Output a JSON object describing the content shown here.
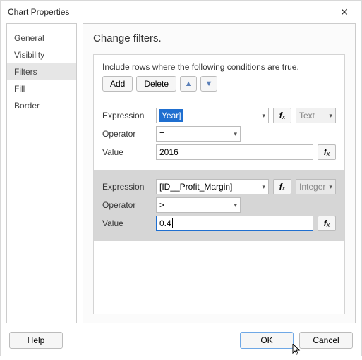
{
  "dialog": {
    "title": "Chart Properties",
    "close_label": "✕"
  },
  "sidebar": {
    "items": [
      {
        "label": "General"
      },
      {
        "label": "Visibility"
      },
      {
        "label": "Filters"
      },
      {
        "label": "Fill"
      },
      {
        "label": "Border"
      }
    ],
    "active_index": 2
  },
  "panel": {
    "heading": "Change filters.",
    "instruction": "Include rows where the following conditions are true.",
    "toolbar": {
      "add_label": "Add",
      "delete_label": "Delete",
      "move_up_icon": "▲",
      "move_down_icon": "▼"
    },
    "labels": {
      "expression": "Expression",
      "operator": "Operator",
      "value": "Value",
      "fx": "fx"
    },
    "filters": [
      {
        "expression": "[Year]",
        "expression_display": "Year]",
        "operator": "=",
        "value": "2016",
        "type": "Text"
      },
      {
        "expression": "[ID__Profit_Margin]",
        "operator": "> =",
        "value": "0.4",
        "type": "Integer"
      }
    ]
  },
  "footer": {
    "help_label": "Help",
    "ok_label": "OK",
    "cancel_label": "Cancel"
  }
}
